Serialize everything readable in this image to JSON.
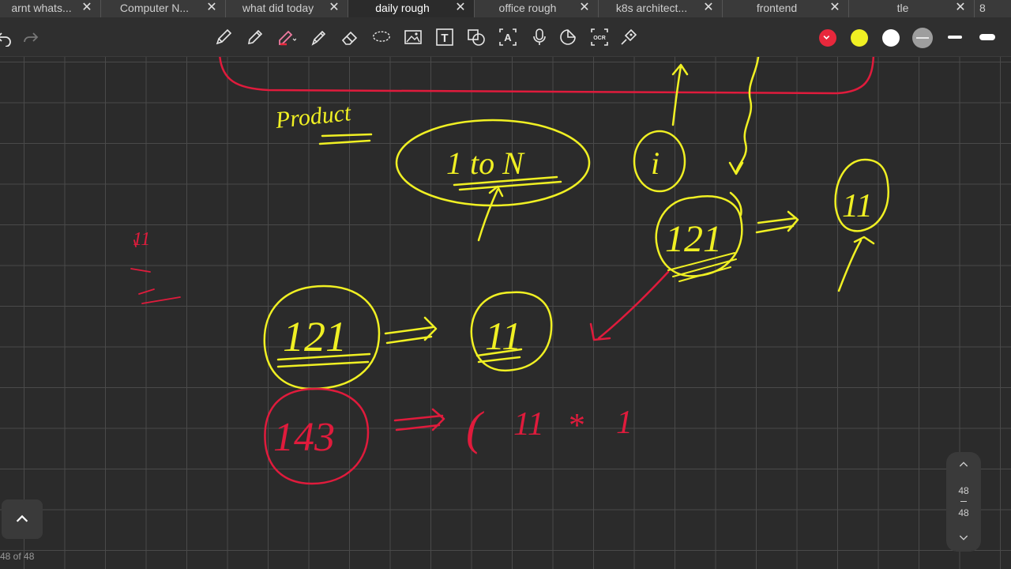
{
  "tabs": [
    {
      "label": "arnt whats...",
      "active": false
    },
    {
      "label": "Computer N...",
      "active": false
    },
    {
      "label": "what did today",
      "active": false
    },
    {
      "label": "daily rough",
      "active": true
    },
    {
      "label": "office rough",
      "active": false
    },
    {
      "label": "k8s architect...",
      "active": false
    },
    {
      "label": "frontend",
      "active": false
    },
    {
      "label": "tle",
      "active": false
    }
  ],
  "tab_count": "8",
  "tab_close_glyph": "✕",
  "toolbar": {
    "tools": [
      "undo-icon",
      "redo-icon",
      "pen-icon",
      "pencil-icon",
      "highlighter-icon",
      "marker-icon",
      "eraser-icon",
      "lasso-icon",
      "image-icon",
      "text-icon",
      "shapes-icon",
      "text-recognition-icon",
      "microphone-icon",
      "sticker-icon",
      "ocr-icon",
      "laser-pointer-icon"
    ],
    "ocr_label": "OCR",
    "text_tool_glyph": "T",
    "recognize_glyph": "A",
    "colors": [
      "#e8283c",
      "#f0f023",
      "#ffffff",
      "#9e9e9e"
    ]
  },
  "ink": {
    "yellow": "#f0f023",
    "red": "#e01b3c",
    "texts": {
      "product": "Product",
      "one_to_n": "1 to N",
      "i_letter": "i",
      "n121_top": "121",
      "n11_right": "11",
      "n121_left": "121",
      "n11_mid": "11",
      "n143": "143",
      "small_11": "11",
      "expr_11": "11",
      "expr_star": "*",
      "expr_1": "1",
      "paren": "("
    }
  },
  "page_nav": {
    "current": "48",
    "total": "48"
  },
  "page_indicator": "48 of 48"
}
